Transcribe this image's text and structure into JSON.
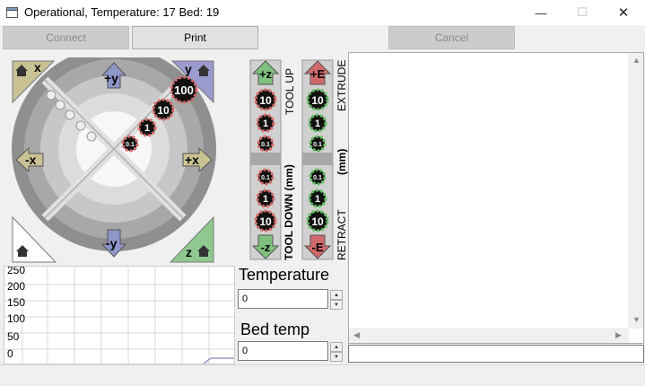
{
  "window": {
    "title": "Operational, Temperature: 17 Bed: 19",
    "minimize_glyph": "—",
    "maximize_glyph": "☐",
    "close_glyph": "✕"
  },
  "toolbar": {
    "connect_label": "Connect",
    "print_label": "Print",
    "cancel_label": "Cancel"
  },
  "xy_pad": {
    "home_x": "x",
    "home_y": "y",
    "home_z": "z",
    "plus_y": "+y",
    "minus_y": "-y",
    "plus_x": "+x",
    "minus_x": "-x",
    "step_100": "100",
    "step_10": "10",
    "step_1": "1",
    "step_01": "0.1"
  },
  "z_column": {
    "plus": "+z",
    "minus": "-z",
    "steps_up": [
      "10",
      "1",
      "0.1"
    ],
    "steps_down": [
      "0.1",
      "1",
      "10"
    ],
    "label_up": "TOOL UP",
    "label_down": "TOOL DOWN (mm)"
  },
  "e_column": {
    "plus": "+E",
    "minus": "-E",
    "steps_up": [
      "10",
      "1",
      "0.1"
    ],
    "steps_down": [
      "0.1",
      "1",
      "10"
    ],
    "label_up": "EXTRUDE",
    "label_mid": "(mm)",
    "label_down": "RETRACT"
  },
  "graph": {
    "y_labels": [
      "250",
      "200",
      "150",
      "100",
      "50",
      "0"
    ]
  },
  "temperature": {
    "title": "Temperature",
    "value": "0"
  },
  "bed": {
    "title": "Bed temp",
    "value": "0"
  },
  "colors": {
    "z_plus": "#7fc07f",
    "z_minus": "#7fc07f",
    "e_plus": "#d06a6a",
    "e_minus": "#d06a6a",
    "home_xy": "#c9c293",
    "home_y": "#9b9bd0",
    "home_z": "#8fc98f"
  }
}
